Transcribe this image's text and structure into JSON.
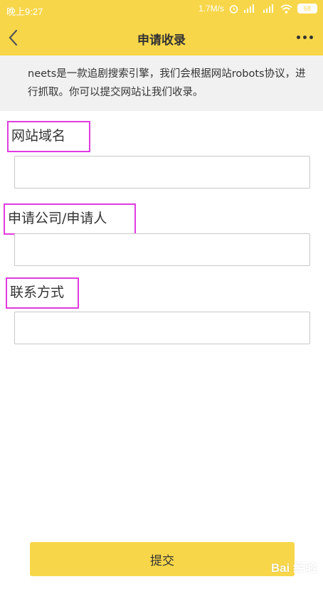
{
  "status": {
    "time": "晚上9:27",
    "net_speed": "1.7M/s",
    "battery": "68"
  },
  "nav": {
    "title": "申请收录"
  },
  "notice": {
    "text": "neets是一款追剧搜索引擎，我们会根据网站robots协议，进行抓取。你可以提交网站让我们收录。"
  },
  "form": {
    "domain_label": "网站域名",
    "domain_value": "",
    "company_label": "申请公司/申请人",
    "company_value": "",
    "contact_label": "联系方式",
    "contact_value": "",
    "submit_label": "提交"
  },
  "watermark": {
    "text": "Bai 经验"
  },
  "colors": {
    "accent": "#f7d64a",
    "highlight_border": "#e03ce0",
    "notice_bg": "#f1f1f1"
  }
}
